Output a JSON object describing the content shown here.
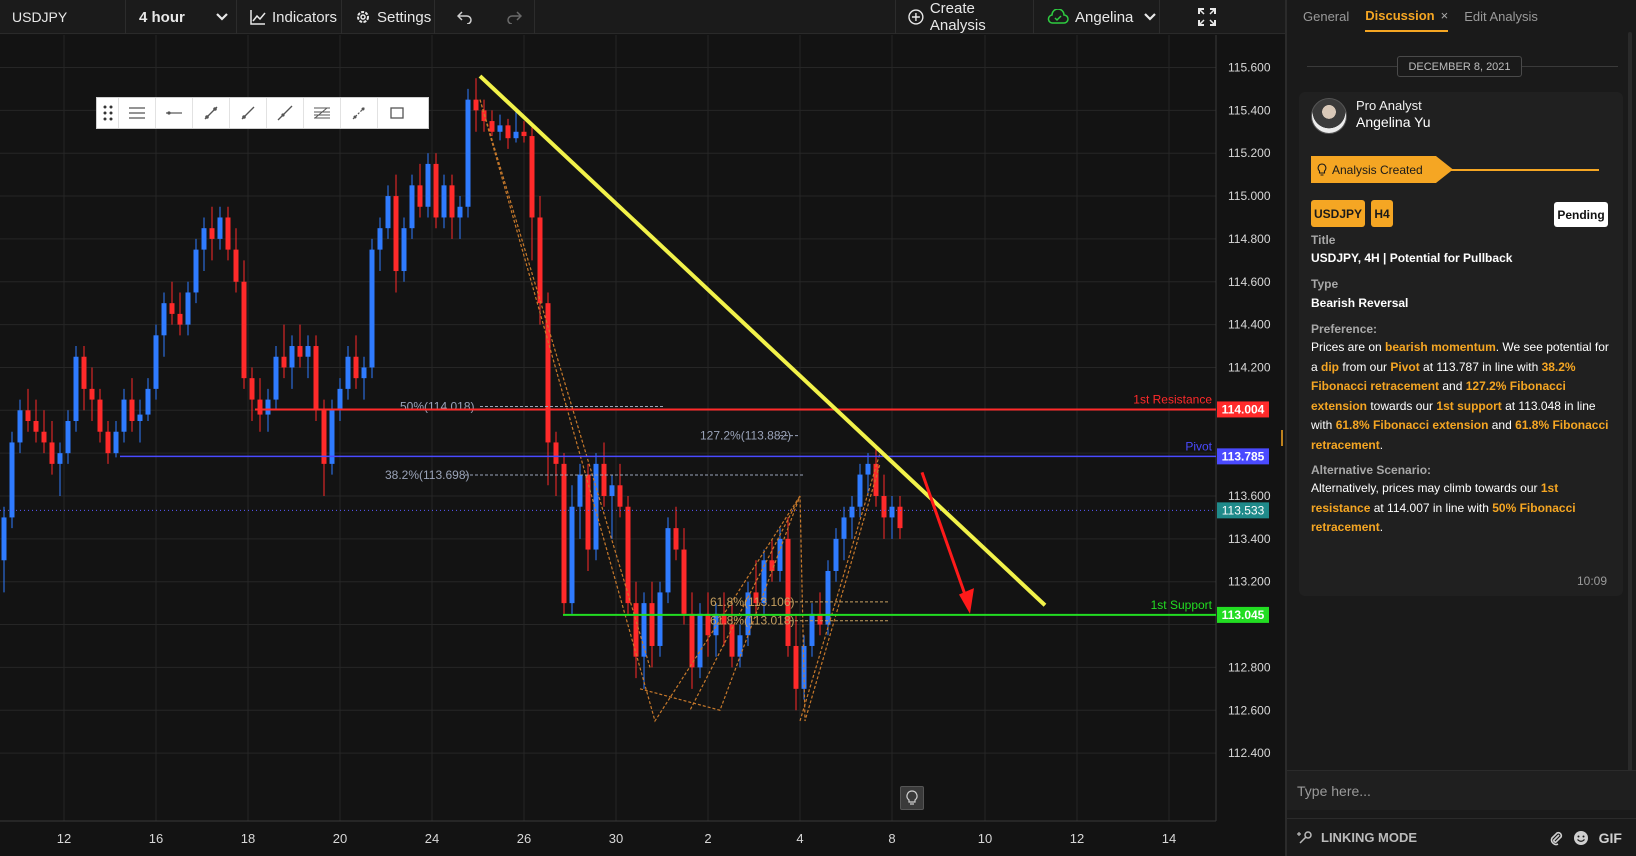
{
  "toolbar": {
    "symbol": "USDJPY",
    "interval": "4 hour",
    "indicators_label": "Indicators",
    "settings_label": "Settings",
    "create_analysis_label": "Create Analysis",
    "user_label": "Angelina"
  },
  "chart_data": {
    "type": "candlestick",
    "symbol": "USDJPY",
    "interval": "4 hour",
    "y_ticks": [
      "115.600",
      "115.400",
      "115.200",
      "115.000",
      "114.800",
      "114.600",
      "114.400",
      "114.200",
      "113.600",
      "113.400",
      "113.200",
      "112.800",
      "112.600",
      "112.400"
    ],
    "x_ticks": [
      "12",
      "16",
      "18",
      "20",
      "24",
      "26",
      "30",
      "2",
      "4",
      "8",
      "10",
      "12",
      "14"
    ],
    "ylim": [
      112.3,
      115.7
    ],
    "current_price": "113.533",
    "current_price_value": 113.533,
    "levels": [
      {
        "label": "1st Resistance",
        "price": "114.004",
        "value": 114.004,
        "color": "#ff2a2a"
      },
      {
        "label": "Pivot",
        "price": "113.785",
        "value": 113.785,
        "color": "#4a4aff"
      },
      {
        "label": "1st Support",
        "price": "113.045",
        "value": 113.045,
        "color": "#22dd22"
      }
    ],
    "fib_labels": [
      {
        "text": "50%(114.018)",
        "value": 114.018
      },
      {
        "text": "127.2%(113.882)",
        "value": 113.882
      },
      {
        "text": "38.2%(113.698)",
        "value": 113.698
      },
      {
        "text": "61.8%(113.106)",
        "value": 113.106
      },
      {
        "text": "61.8%(113.018)",
        "value": 113.018
      }
    ],
    "grid": true
  },
  "panel": {
    "tabs": {
      "general": "General",
      "discussion": "Discussion",
      "edit": "Edit Analysis"
    },
    "date": "DECEMBER 8, 2021",
    "author_role": "Pro Analyst",
    "author_name": "Angelina Yu",
    "status_banner": "Analysis Created",
    "chip_symbol": "USDJPY",
    "chip_tf": "H4",
    "pending_label": "Pending",
    "title_label": "Title",
    "title_value": "USDJPY, 4H | Potential for Pullback",
    "type_label": "Type",
    "type_value": "Bearish Reversal",
    "preference_label": "Preference:",
    "pref": {
      "p1": "Prices are on ",
      "h1": "bearish momentum",
      "p2": ". We see potential for a ",
      "h2": "dip",
      "p3": " from our ",
      "h3": "Pivot",
      "p4": " at 113.787 in line with ",
      "h4": "38.2% Fibonacci retracement",
      "p5": " and ",
      "h5": "127.2% Fibonacci extension",
      "p6": " towards our ",
      "h6": "1st support",
      "p7": " at 113.048 in line with ",
      "h7": "61.8% Fibonacci extension",
      "p8": " and ",
      "h8": "61.8% Fibonacci retracement",
      "p9": "."
    },
    "alt_label": "Alternative Scenario:",
    "alt": {
      "p1": "Alternatively, prices may climb towards our ",
      "h1": "1st resistance",
      "p2": " at 114.007 in line with ",
      "h2": "50% Fibonacci retracement",
      "p3": "."
    },
    "time": "10:09",
    "input_placeholder": "Type here...",
    "linking_mode_label": "LINKING MODE",
    "gif_label": "GIF"
  },
  "colors": {
    "accent": "#f5a623",
    "bull": "#2f7bff",
    "bear": "#ff2a2a",
    "trendline": "#f2f24a"
  }
}
